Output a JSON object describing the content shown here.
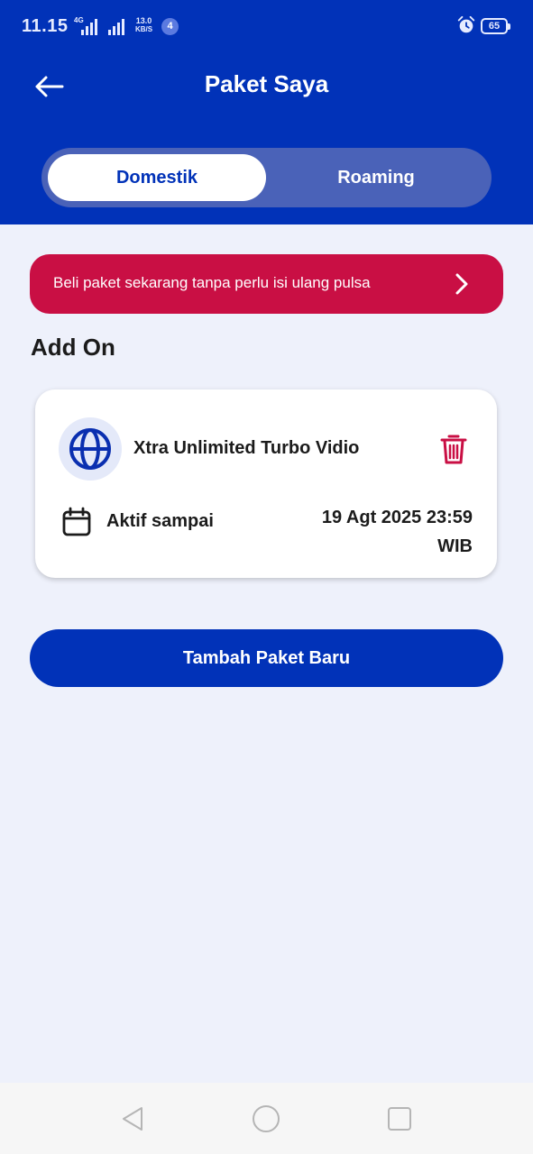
{
  "status_bar": {
    "time": "11.15",
    "network": "4G",
    "speed_top": "13.0",
    "speed_bottom": "KB/S",
    "notification_count": "4",
    "battery": "65"
  },
  "header": {
    "title": "Paket Saya",
    "back_icon": "arrow-left-icon"
  },
  "tabs": [
    {
      "label": "Domestik",
      "active": true
    },
    {
      "label": "Roaming",
      "active": false
    }
  ],
  "promo": {
    "text": "Beli paket sekarang tanpa perlu isi ulang pulsa",
    "icon": "chevron-right-icon"
  },
  "section": {
    "title": "Add On"
  },
  "package": {
    "name": "Xtra Unlimited Turbo Vidio",
    "icon": "globe-icon",
    "delete_icon": "trash-icon",
    "active_label": "Aktif sampai",
    "active_until_date": "19 Agt 2025 23:59",
    "active_until_tz": "WIB"
  },
  "actions": {
    "add_package": "Tambah Paket Baru"
  },
  "colors": {
    "primary": "#0132b8",
    "promo": "#c90f44",
    "background": "#eef1fb"
  }
}
